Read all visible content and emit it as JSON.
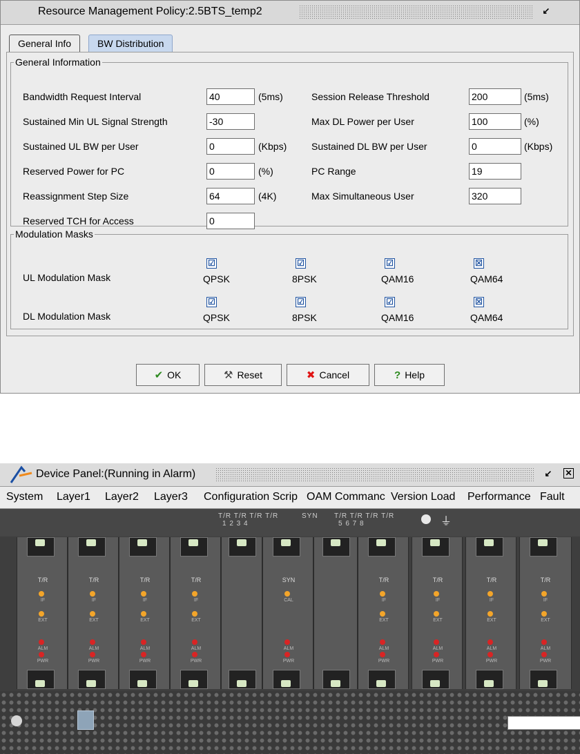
{
  "dialog": {
    "title": "Resource Management Policy:2.5BTS_temp2",
    "tabs": [
      "General Info",
      "BW Distribution"
    ],
    "general_info_group": "General Information",
    "fields": {
      "bw_request_interval": {
        "label": "Bandwidth Request Interval",
        "value": "40",
        "unit": "(5ms)"
      },
      "sustained_min_ul_signal": {
        "label": "Sustained Min UL Signal Strength",
        "value": "-30",
        "unit": ""
      },
      "sustained_ul_bw": {
        "label": "Sustained UL BW per User",
        "value": "0",
        "unit": "(Kbps)"
      },
      "reserved_power_pc": {
        "label": "Reserved Power for PC",
        "value": "0",
        "unit": "(%)"
      },
      "reassignment_step": {
        "label": "Reassignment Step Size",
        "value": "64",
        "unit": "(4K)"
      },
      "reserved_tch": {
        "label": "Reserved TCH for Access",
        "value": "0",
        "unit": ""
      },
      "session_release": {
        "label": "Session Release Threshold",
        "value": "200",
        "unit": "(5ms)"
      },
      "max_dl_power": {
        "label": "Max DL Power per User",
        "value": "100",
        "unit": "(%)"
      },
      "sustained_dl_bw": {
        "label": "Sustained DL BW per User",
        "value": "0",
        "unit": "(Kbps)"
      },
      "pc_range": {
        "label": "PC Range",
        "value": "19",
        "unit": ""
      },
      "max_sim_user": {
        "label": "Max Simultaneous User",
        "value": "320",
        "unit": ""
      }
    },
    "modulation_group": "Modulation Masks",
    "ul_mask_label": "UL Modulation Mask",
    "dl_mask_label": "DL Modulation Mask",
    "mod_names": [
      "QPSK",
      "8PSK",
      "QAM16",
      "QAM64"
    ],
    "ul_mask_marks": [
      "☑",
      "☑",
      "☑",
      "☒"
    ],
    "dl_mask_marks": [
      "☑",
      "☑",
      "☑",
      "☒"
    ],
    "buttons": {
      "ok": "OK",
      "reset": "Reset",
      "cancel": "Cancel",
      "help": "Help"
    }
  },
  "device": {
    "title": "Device Panel:(Running in Alarm)",
    "menu": [
      "System",
      "Layer1",
      "Layer2",
      "Layer3",
      "Configuration Scrip",
      "OAM Commanc",
      "Version Load",
      "Performance",
      "Fault"
    ],
    "top_labels": [
      "T/R T/R T/R T/R",
      "1    2    3    4",
      "SYN",
      "T/R T/R T/R T/R",
      "5    6    7    8"
    ],
    "cards": [
      "T/R",
      "T/R",
      "T/R",
      "",
      "SYN",
      "",
      "T/R",
      "T/R",
      "T/R",
      "T/R"
    ],
    "led_labels": {
      "if": "IF",
      "ext": "EXT",
      "cal": "CAL",
      "alm": "ALM",
      "pwr": "PWR"
    }
  },
  "colors": {
    "tab_active": "#c8d8ee",
    "check_blue": "#1e52a0",
    "led_orange": "#f3a52a",
    "led_red": "#d92424"
  }
}
